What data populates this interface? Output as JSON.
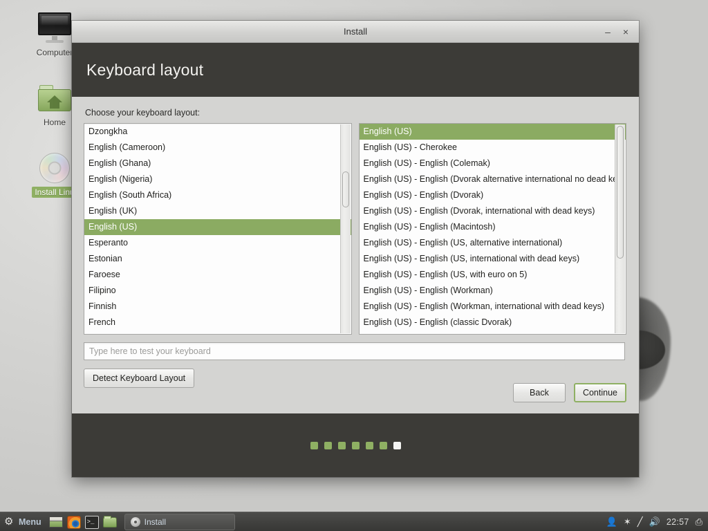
{
  "desktop": {
    "icons": [
      {
        "name": "computer",
        "label": "Computer",
        "selected": false
      },
      {
        "name": "home",
        "label": "Home",
        "selected": false
      },
      {
        "name": "install-linux-mint",
        "label": "Install Linu",
        "selected": true
      }
    ]
  },
  "window": {
    "title": "Install",
    "minimize_glyph": "–",
    "close_glyph": "×",
    "header_title": "Keyboard layout"
  },
  "main": {
    "choose_label": "Choose your keyboard layout:",
    "left_list": {
      "items": [
        "Dzongkha",
        "English (Cameroon)",
        "English (Ghana)",
        "English (Nigeria)",
        "English (South Africa)",
        "English (UK)",
        "English (US)",
        "Esperanto",
        "Estonian",
        "Faroese",
        "Filipino",
        "Finnish",
        "French"
      ],
      "selected_index": 6
    },
    "right_list": {
      "items": [
        "English (US)",
        "English (US) - Cherokee",
        "English (US) - English (Colemak)",
        "English (US) - English (Dvorak alternative international no dead ke",
        "English (US) - English (Dvorak)",
        "English (US) - English (Dvorak, international with dead keys)",
        "English (US) - English (Macintosh)",
        "English (US) - English (US, alternative international)",
        "English (US) - English (US, international with dead keys)",
        "English (US) - English (US, with euro on 5)",
        "English (US) - English (Workman)",
        "English (US) - English (Workman, international with dead keys)",
        "English (US) - English (classic Dvorak)"
      ],
      "selected_index": 0
    },
    "test_input": {
      "value": "",
      "placeholder": "Type here to test your keyboard"
    },
    "detect_button": "Detect Keyboard Layout",
    "back_button": "Back",
    "continue_button": "Continue"
  },
  "footer": {
    "total_dots": 7,
    "current_dot": 7
  },
  "taskbar": {
    "menu_label": "Menu",
    "menu_icon": "gear-icon",
    "launchers": [
      {
        "name": "show-desktop",
        "tip": "Show Desktop"
      },
      {
        "name": "firefox",
        "tip": "Firefox Web Browser"
      },
      {
        "name": "terminal",
        "tip": "Terminal"
      },
      {
        "name": "file-manager",
        "tip": "Files"
      }
    ],
    "windows": [
      {
        "name": "install",
        "label": "Install",
        "icon": "disc-icon",
        "active": true
      }
    ],
    "tray": [
      {
        "name": "user-icon",
        "glyph": "👤"
      },
      {
        "name": "bluetooth-icon",
        "glyph": "✶"
      },
      {
        "name": "update-manager-icon",
        "glyph": "╱"
      },
      {
        "name": "volume-icon",
        "glyph": "🔊"
      }
    ],
    "clock": "22:57",
    "workspace_icon": "window-switcher-icon"
  },
  "colors": {
    "accent_green": "#8bab62",
    "header_dark": "#3c3b37",
    "window_bg": "#d4d4d2",
    "taskbar_dark": "#3f3f3d"
  }
}
